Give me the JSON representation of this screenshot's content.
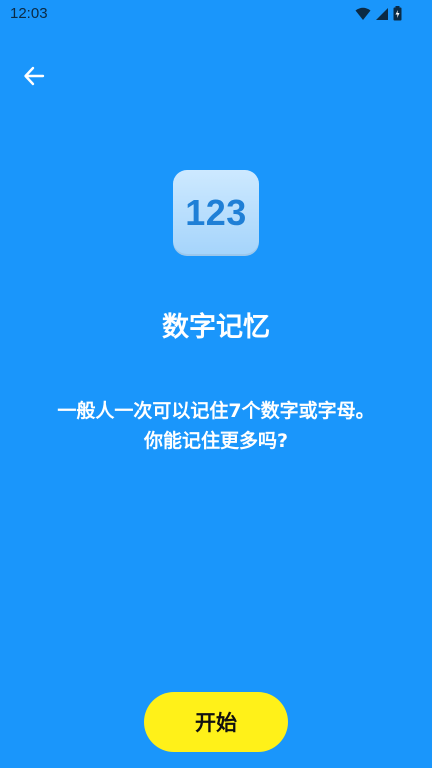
{
  "status_bar": {
    "time": "12:03",
    "icons": [
      "wifi-icon",
      "cell-signal-icon",
      "battery-icon"
    ]
  },
  "nav": {
    "back_icon": "arrow-left-icon"
  },
  "app_icon": {
    "text": "123"
  },
  "content": {
    "title": "数字记忆",
    "description_line1": "一般人一次可以记住7个数字或字母。",
    "description_line2": "你能记住更多吗?"
  },
  "actions": {
    "start_label": "开始"
  },
  "colors": {
    "background": "#1a96fb",
    "start_button": "#fff119",
    "icon_bg": "#cde9ff",
    "icon_text": "#1f7fd6"
  }
}
